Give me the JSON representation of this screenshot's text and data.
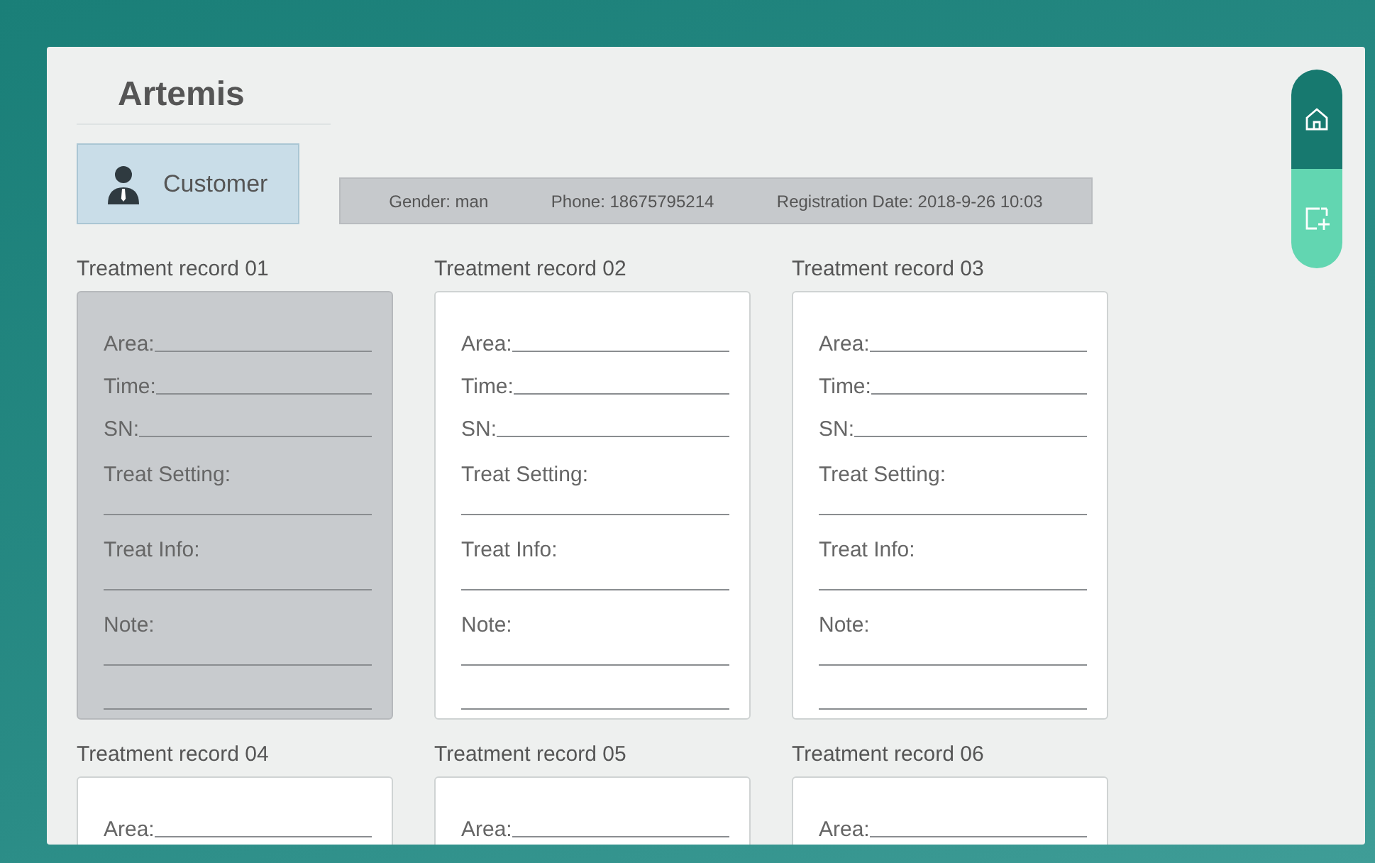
{
  "app": {
    "title": "Artemis"
  },
  "customer": {
    "label": "Customer",
    "selected": true
  },
  "info": [
    "Gender: man",
    "Phone: 18675795214",
    "Registration Date: 2018-9-26 10:03"
  ],
  "side_nav": [
    {
      "kind": "home",
      "selected": true
    },
    {
      "kind": "add",
      "selected": false
    }
  ],
  "records": [
    {
      "title": "Treatment record 01",
      "selected": true,
      "fields": [
        {
          "label": "Area:",
          "kind": "inline"
        },
        {
          "label": "Time:",
          "kind": "inline"
        },
        {
          "label": "SN:",
          "kind": "inline"
        },
        {
          "label": "Treat Setting:",
          "kind": "block"
        },
        {
          "label": "Treat Info:",
          "kind": "block"
        },
        {
          "label": "Note:",
          "kind": "note"
        }
      ]
    },
    {
      "title": "Treatment record 02",
      "selected": false,
      "fields": [
        {
          "label": "Area:",
          "kind": "inline"
        },
        {
          "label": "Time:",
          "kind": "inline"
        },
        {
          "label": "SN:",
          "kind": "inline"
        },
        {
          "label": "Treat Setting:",
          "kind": "block"
        },
        {
          "label": "Treat Info:",
          "kind": "block"
        },
        {
          "label": "Note:",
          "kind": "note"
        }
      ]
    },
    {
      "title": "Treatment record 03",
      "selected": false,
      "fields": [
        {
          "label": "Area:",
          "kind": "inline"
        },
        {
          "label": "Time:",
          "kind": "inline"
        },
        {
          "label": "SN:",
          "kind": "inline"
        },
        {
          "label": "Treat Setting:",
          "kind": "block"
        },
        {
          "label": "Treat Info:",
          "kind": "block"
        },
        {
          "label": "Note:",
          "kind": "note"
        }
      ]
    },
    {
      "title": "Treatment record 04",
      "selected": false,
      "fields": [
        {
          "label": "Area:",
          "kind": "inline"
        }
      ]
    },
    {
      "title": "Treatment record 05",
      "selected": false,
      "fields": [
        {
          "label": "Area:",
          "kind": "inline"
        }
      ]
    },
    {
      "title": "Treatment record 06",
      "selected": false,
      "fields": [
        {
          "label": "Area:",
          "kind": "inline"
        }
      ]
    }
  ]
}
